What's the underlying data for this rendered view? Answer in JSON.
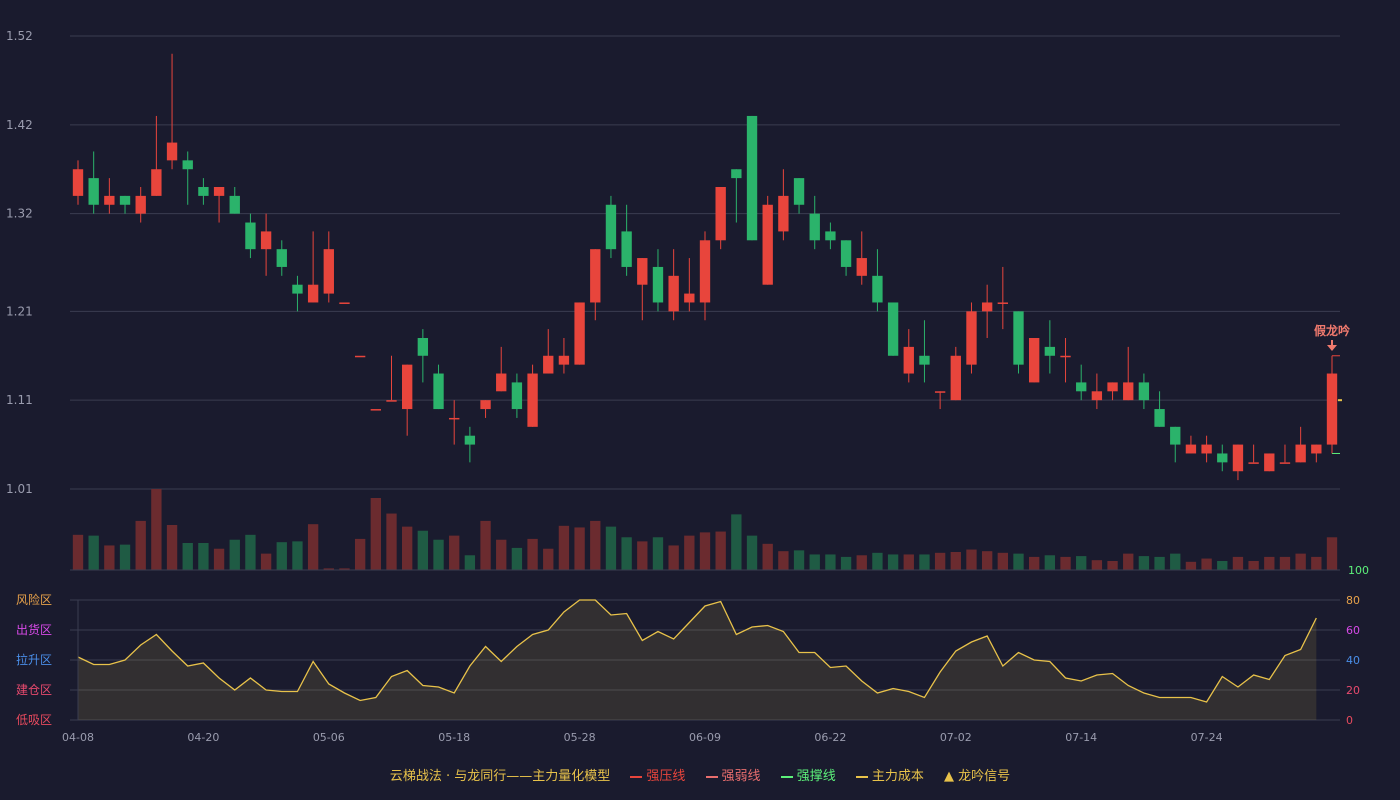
{
  "chart_data": [
    {
      "type": "candlestick",
      "ylim": [
        1.01,
        1.52
      ],
      "yticks": [
        "1.52",
        "1.42",
        "1.32",
        "1.21",
        "1.11",
        "1.01"
      ],
      "xticks": [
        "04-08",
        "04-20",
        "05-06",
        "05-18",
        "05-28",
        "06-09",
        "06-22",
        "07-02",
        "07-14",
        "07-24"
      ],
      "xtick_index": [
        0,
        8,
        16,
        24,
        32,
        40,
        48,
        56,
        64,
        72
      ],
      "candles": [
        [
          1.34,
          1.37,
          1.38,
          1.33
        ],
        [
          1.36,
          1.33,
          1.39,
          1.32
        ],
        [
          1.33,
          1.34,
          1.36,
          1.32
        ],
        [
          1.34,
          1.33,
          1.34,
          1.32
        ],
        [
          1.32,
          1.34,
          1.35,
          1.31
        ],
        [
          1.34,
          1.37,
          1.43,
          1.34
        ],
        [
          1.38,
          1.4,
          1.5,
          1.37
        ],
        [
          1.38,
          1.37,
          1.39,
          1.33
        ],
        [
          1.35,
          1.34,
          1.36,
          1.33
        ],
        [
          1.34,
          1.35,
          1.35,
          1.31
        ],
        [
          1.34,
          1.32,
          1.35,
          1.32
        ],
        [
          1.31,
          1.28,
          1.32,
          1.27
        ],
        [
          1.28,
          1.3,
          1.32,
          1.25
        ],
        [
          1.28,
          1.26,
          1.29,
          1.25
        ],
        [
          1.24,
          1.23,
          1.25,
          1.21
        ],
        [
          1.22,
          1.24,
          1.3,
          1.22
        ],
        [
          1.23,
          1.28,
          1.3,
          1.22
        ],
        [
          1.22,
          1.22,
          1.22,
          1.22
        ],
        [
          1.16,
          1.16,
          1.16,
          1.16
        ],
        [
          1.1,
          1.1,
          1.1,
          1.1
        ],
        [
          1.11,
          1.11,
          1.16,
          1.11
        ],
        [
          1.1,
          1.15,
          1.15,
          1.07
        ],
        [
          1.18,
          1.16,
          1.19,
          1.13
        ],
        [
          1.14,
          1.1,
          1.15,
          1.1
        ],
        [
          1.09,
          1.09,
          1.11,
          1.06
        ],
        [
          1.07,
          1.06,
          1.08,
          1.04
        ],
        [
          1.1,
          1.11,
          1.11,
          1.09
        ],
        [
          1.12,
          1.14,
          1.17,
          1.12
        ],
        [
          1.13,
          1.1,
          1.14,
          1.09
        ],
        [
          1.08,
          1.14,
          1.15,
          1.08
        ],
        [
          1.14,
          1.16,
          1.19,
          1.14
        ],
        [
          1.15,
          1.16,
          1.18,
          1.14
        ],
        [
          1.15,
          1.22,
          1.22,
          1.15
        ],
        [
          1.22,
          1.28,
          1.28,
          1.2
        ],
        [
          1.33,
          1.28,
          1.34,
          1.27
        ],
        [
          1.3,
          1.26,
          1.33,
          1.25
        ],
        [
          1.24,
          1.27,
          1.27,
          1.2
        ],
        [
          1.26,
          1.22,
          1.28,
          1.21
        ],
        [
          1.21,
          1.25,
          1.28,
          1.2
        ],
        [
          1.22,
          1.23,
          1.27,
          1.21
        ],
        [
          1.22,
          1.29,
          1.3,
          1.2
        ],
        [
          1.29,
          1.35,
          1.35,
          1.28
        ],
        [
          1.37,
          1.36,
          1.37,
          1.31
        ],
        [
          1.43,
          1.29,
          1.43,
          1.29
        ],
        [
          1.24,
          1.33,
          1.34,
          1.24
        ],
        [
          1.3,
          1.34,
          1.37,
          1.29
        ],
        [
          1.36,
          1.33,
          1.36,
          1.32
        ],
        [
          1.32,
          1.29,
          1.34,
          1.28
        ],
        [
          1.3,
          1.29,
          1.31,
          1.28
        ],
        [
          1.29,
          1.26,
          1.29,
          1.25
        ],
        [
          1.25,
          1.27,
          1.3,
          1.24
        ],
        [
          1.25,
          1.22,
          1.28,
          1.21
        ],
        [
          1.22,
          1.16,
          1.22,
          1.16
        ],
        [
          1.14,
          1.17,
          1.19,
          1.13
        ],
        [
          1.16,
          1.15,
          1.2,
          1.13
        ],
        [
          1.12,
          1.12,
          1.12,
          1.1
        ],
        [
          1.11,
          1.16,
          1.17,
          1.11
        ],
        [
          1.15,
          1.21,
          1.22,
          1.14
        ],
        [
          1.21,
          1.22,
          1.24,
          1.18
        ],
        [
          1.22,
          1.22,
          1.26,
          1.19
        ],
        [
          1.21,
          1.15,
          1.21,
          1.14
        ],
        [
          1.13,
          1.18,
          1.18,
          1.13
        ],
        [
          1.17,
          1.16,
          1.2,
          1.14
        ],
        [
          1.16,
          1.16,
          1.18,
          1.13
        ],
        [
          1.13,
          1.12,
          1.15,
          1.11
        ],
        [
          1.11,
          1.12,
          1.14,
          1.1
        ],
        [
          1.12,
          1.13,
          1.13,
          1.11
        ],
        [
          1.11,
          1.13,
          1.17,
          1.11
        ],
        [
          1.13,
          1.11,
          1.14,
          1.1
        ],
        [
          1.1,
          1.08,
          1.12,
          1.08
        ],
        [
          1.08,
          1.06,
          1.08,
          1.04
        ],
        [
          1.05,
          1.06,
          1.07,
          1.05
        ],
        [
          1.05,
          1.06,
          1.07,
          1.04
        ],
        [
          1.05,
          1.04,
          1.06,
          1.03
        ],
        [
          1.03,
          1.06,
          1.06,
          1.02
        ],
        [
          1.04,
          1.04,
          1.06,
          1.04
        ],
        [
          1.03,
          1.05,
          1.05,
          1.03
        ],
        [
          1.04,
          1.04,
          1.06,
          1.04
        ],
        [
          1.04,
          1.06,
          1.08,
          1.04
        ],
        [
          1.05,
          1.06,
          1.06,
          1.04
        ],
        [
          1.06,
          1.14,
          1.16,
          1.05
        ]
      ],
      "volume": [
        43,
        42,
        30,
        31,
        60,
        99,
        55,
        33,
        33,
        26,
        37,
        43,
        20,
        34,
        35,
        56,
        2,
        2,
        38,
        88,
        69,
        53,
        48,
        37,
        42,
        18,
        60,
        37,
        27,
        38,
        26,
        54,
        52,
        60,
        53,
        40,
        35,
        40,
        30,
        42,
        46,
        47,
        68,
        42,
        32,
        23,
        24,
        19,
        19,
        16,
        18,
        21,
        19,
        19,
        19,
        21,
        22,
        25,
        23,
        21,
        20,
        16,
        18,
        16,
        17,
        12,
        11,
        20,
        17,
        16,
        20,
        10,
        14,
        11,
        16,
        11,
        16,
        16,
        20,
        16,
        40
      ],
      "volume_axis": [
        "100"
      ]
    },
    {
      "type": "area",
      "ylim": [
        0,
        80
      ],
      "yticks": [
        "80",
        "60",
        "40",
        "20",
        "0"
      ],
      "zones": [
        "风险区",
        "出货区",
        "拉升区",
        "建仓区",
        "低吸区"
      ],
      "values": [
        42,
        37,
        37,
        40,
        50,
        57,
        46,
        36,
        38,
        28,
        20,
        28,
        20,
        19,
        19,
        39,
        24,
        18,
        13,
        15,
        29,
        33,
        23,
        22,
        18,
        36,
        49,
        39,
        49,
        57,
        60,
        72,
        80,
        80,
        70,
        71,
        53,
        59,
        54,
        65,
        76,
        79,
        57,
        62,
        63,
        59,
        45,
        45,
        35,
        36,
        26,
        18,
        21,
        19,
        15,
        32,
        46,
        52,
        56,
        36,
        45,
        40,
        39,
        28,
        26,
        30,
        31,
        23,
        18,
        15,
        15,
        15,
        12,
        29,
        22,
        30,
        27,
        43,
        47,
        68
      ]
    }
  ],
  "annotation": {
    "label": "假龙吟"
  },
  "legend": {
    "title": "云梯战法 · 与龙同行——主力量化模型",
    "items": [
      "强压线",
      "强弱线",
      "强撑线",
      "主力成本",
      "龙吟信号"
    ],
    "colors": [
      "#e8453c",
      "#e86e6e",
      "#5cf07a",
      "#e8c24a",
      "#e8c24a"
    ]
  },
  "colors": {
    "up": "#e8453c",
    "down": "#2bb36b",
    "vol_up": "#6b2b2f",
    "vol_down": "#1f5b44",
    "grid": "#3a3c50",
    "axis_text": "#9a9cae",
    "line": "#e8c24a"
  }
}
